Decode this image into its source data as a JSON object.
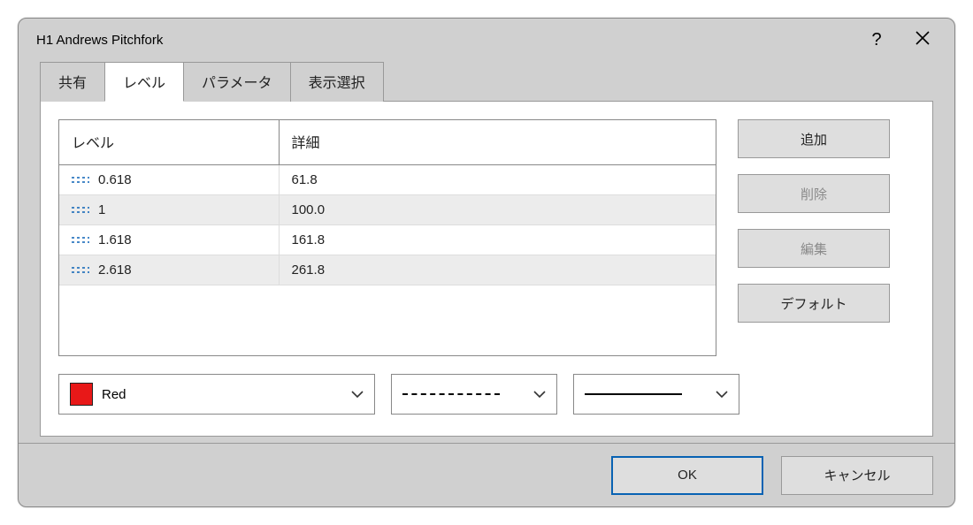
{
  "title": "H1 Andrews Pitchfork",
  "tabs": [
    {
      "label": "共有",
      "active": false
    },
    {
      "label": "レベル",
      "active": true
    },
    {
      "label": "パラメータ",
      "active": false
    },
    {
      "label": "表示選択",
      "active": false
    }
  ],
  "table": {
    "headers": {
      "level": "レベル",
      "detail": "詳細"
    },
    "rows": [
      {
        "level": "0.618",
        "detail": "61.8"
      },
      {
        "level": "1",
        "detail": "100.0"
      },
      {
        "level": "1.618",
        "detail": "161.8"
      },
      {
        "level": "2.618",
        "detail": "261.8"
      }
    ]
  },
  "sideButtons": {
    "add": "追加",
    "delete": "削除",
    "edit": "編集",
    "default": "デフォルト"
  },
  "colorSelector": {
    "name": "Red",
    "hex": "#e81818"
  },
  "footer": {
    "ok": "OK",
    "cancel": "キャンセル"
  }
}
